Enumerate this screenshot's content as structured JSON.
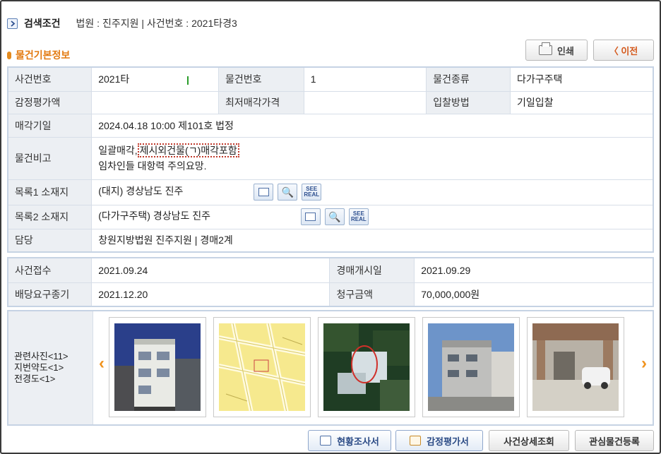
{
  "search": {
    "title": "검색조건",
    "info": "법원 : 진주지원 | 사건번호 : 2021타경3"
  },
  "section": {
    "title": "물건기본정보"
  },
  "buttons": {
    "print": "인쇄",
    "prev": "〈  이전"
  },
  "basic": {
    "case_no_label": "사건번호",
    "case_no_value": "2021타",
    "item_no_label": "물건번호",
    "item_no_value": "1",
    "item_type_label": "물건종류",
    "item_type_value": "다가구주택",
    "appraisal_label": "감정평가액",
    "appraisal_value": "",
    "min_price_label": "최저매각가격",
    "min_price_value": "",
    "bid_method_label": "입찰방법",
    "bid_method_value": "기일입찰",
    "sale_date_label": "매각기일",
    "sale_date_value": "2024.04.18 10:00 제101호 법정",
    "remarks_label": "물건비고",
    "remarks_prefix": "일괄매각,",
    "remarks_highlight": "제시외건물(ㄱ)매각포함",
    "remarks_line2": "임차인들 대항력 주의요망.",
    "addr1_label": "목록1 소재지",
    "addr1_value": "(대지) 경상남도 진주",
    "addr2_label": "목록2 소재지",
    "addr2_value": "(다가구주택) 경상남도 진주",
    "charge_label": "담당",
    "charge_value": "창원지방법원 진주지원 | 경매2계"
  },
  "case": {
    "received_label": "사건접수",
    "received_value": "2021.09.24",
    "start_label": "경매개시일",
    "start_value": "2021.09.29",
    "deadline_label": "배당요구종기",
    "deadline_value": "2021.12.20",
    "claim_label": "청구금액",
    "claim_value": "70,000,000원"
  },
  "photos": {
    "label_line1": "관련사진<11>",
    "label_line2": "지번약도<1>",
    "label_line3": "전경도<1>",
    "prev_arrow": "‹",
    "next_arrow": "›",
    "icon_see_real": "SEE REAL"
  },
  "bottom": {
    "survey": "현황조사서",
    "appraisal_doc": "감정평가서",
    "case_detail": "사건상세조회",
    "favorite": "관심물건등록"
  }
}
